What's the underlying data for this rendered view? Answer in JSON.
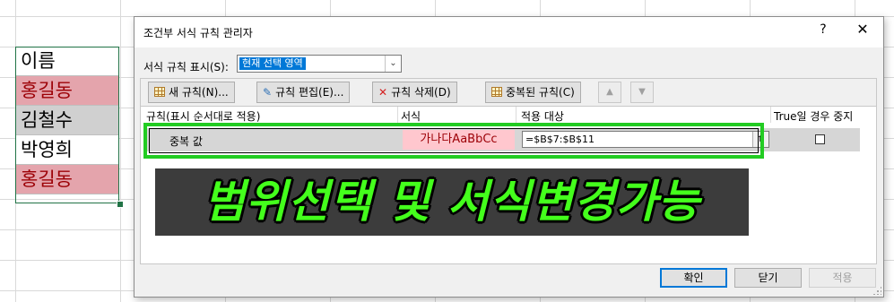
{
  "sheet": {
    "cells": [
      {
        "value": "이름",
        "style": "normal"
      },
      {
        "value": "홍길동",
        "style": "dup"
      },
      {
        "value": "김철수",
        "style": "gray"
      },
      {
        "value": "박영희",
        "style": "normal"
      },
      {
        "value": "홍길동",
        "style": "dup"
      }
    ]
  },
  "dialog": {
    "title": "조건부 서식 규칙 관리자",
    "help_label": "?",
    "close_label": "✕",
    "show_rules_label": "서식 규칙 표시(S):",
    "scope_value": "현재 선택 영역",
    "toolbar": {
      "new_rule": "새 규칙(N)...",
      "edit_rule": "규칙 편집(E)...",
      "delete_rule": "규칙 삭제(D)",
      "duplicate_rule": "중복된 규칙(C)",
      "move_up": "▲",
      "move_down": "▼"
    },
    "columns": {
      "rule": "규칙(표시 순서대로 적용)",
      "format": "서식",
      "applies_to": "적용 대상",
      "stop_if_true": "True일 경우 중지"
    },
    "rules": [
      {
        "name": "중복 값",
        "preview": "가나다AaBbCc",
        "applies_to": "=$B$7:$B$11",
        "stop_if_true": false
      }
    ],
    "buttons": {
      "ok": "확인",
      "close": "닫기",
      "apply": "적용"
    }
  },
  "overlay": {
    "banner": "범위선택 및 서식변경가능"
  },
  "colors": {
    "highlight": "#22cc22",
    "banner_text": "#44ff1c",
    "dup_fill": "#ffc7ce",
    "dup_text": "#9c0006"
  }
}
